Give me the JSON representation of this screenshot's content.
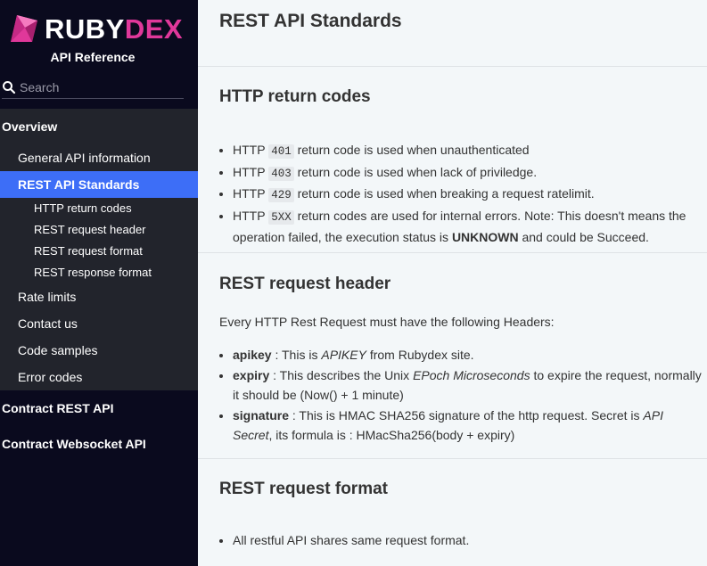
{
  "sidebar": {
    "logo_ruby": "RUBY",
    "logo_dex": "DEX",
    "subtitle": "API Reference",
    "search_placeholder": "Search",
    "nav": [
      {
        "label": "Overview"
      },
      {
        "label": "General API information"
      },
      {
        "label": "REST API Standards"
      },
      {
        "label": "HTTP return codes"
      },
      {
        "label": "REST request header"
      },
      {
        "label": "REST request format"
      },
      {
        "label": "REST response format"
      },
      {
        "label": "Rate limits"
      },
      {
        "label": "Contact us"
      },
      {
        "label": "Code samples"
      },
      {
        "label": "Error codes"
      },
      {
        "label": "Contract REST API"
      },
      {
        "label": "Contract Websocket API"
      }
    ]
  },
  "main": {
    "page_title": "REST API Standards",
    "http_codes": {
      "heading": "HTTP return codes",
      "items": [
        {
          "prefix": "HTTP ",
          "code": "401",
          "text": " return code is used when unauthenticated"
        },
        {
          "prefix": "HTTP ",
          "code": "403",
          "text": " return code is used when lack of priviledge."
        },
        {
          "prefix": "HTTP ",
          "code": "429",
          "text": " return code is used when breaking a request ratelimit."
        },
        {
          "prefix": "HTTP ",
          "code": "5XX",
          "text": " return codes are used for internal errors. Note: This doesn't means the operation failed, the execution status is ",
          "bold": "UNKNOWN",
          "suffix": " and could be Succeed."
        }
      ]
    },
    "request_header": {
      "heading": "REST request header",
      "intro": "Every HTTP Rest Request must have the following Headers:",
      "items": [
        {
          "key": "apikey",
          "t1": " : This is ",
          "i1": "APIKEY",
          "t2": " from Rubydex site."
        },
        {
          "key": "expiry",
          "t1": " : This describes the Unix ",
          "i1": "EPoch Microseconds",
          "t2": " to expire the request, normally it should be (Now() + 1 minute)"
        },
        {
          "key": "signature",
          "t1": " : This is HMAC SHA256 signature of the http request. Secret is ",
          "i1": "API Secret",
          "t2": ", its formula is : HMacSha256(body + expiry)"
        }
      ]
    },
    "request_format": {
      "heading": "REST request format",
      "items": [
        "All restful API shares same request format."
      ]
    }
  }
}
